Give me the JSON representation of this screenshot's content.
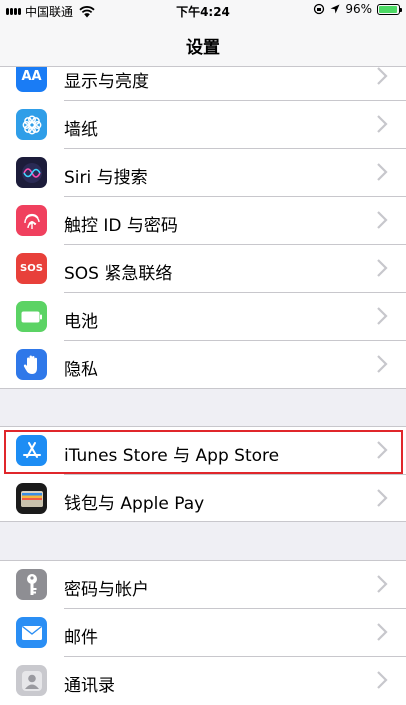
{
  "status": {
    "carrier": "中国联通",
    "time": "下午4:24",
    "battery": "96%",
    "battery_level": 0.96
  },
  "nav": {
    "title": "设置"
  },
  "groups": [
    {
      "items": [
        {
          "label": "显示与亮度",
          "icon": "display-brightness-icon",
          "color": "#1a7cf5"
        },
        {
          "label": "墙纸",
          "icon": "wallpaper-icon",
          "color": "#2f9ee8"
        },
        {
          "label": "Siri 与搜索",
          "icon": "siri-icon",
          "color": "#1c1c3a"
        },
        {
          "label": "触控 ID 与密码",
          "icon": "fingerprint-icon",
          "color": "#f0405e"
        },
        {
          "label": "SOS 紧急联络",
          "icon": "sos-icon",
          "color": "#e8403a"
        },
        {
          "label": "电池",
          "icon": "battery-icon",
          "color": "#5bd364"
        },
        {
          "label": "隐私",
          "icon": "privacy-hand-icon",
          "color": "#2f78e9"
        }
      ]
    },
    {
      "items": [
        {
          "label": "iTunes Store 与 App Store",
          "icon": "app-store-icon",
          "color": "#1d8df4"
        },
        {
          "label": "钱包与 Apple Pay",
          "icon": "wallet-icon",
          "color": "#1b1b1b"
        }
      ]
    },
    {
      "items": [
        {
          "label": "密码与帐户",
          "icon": "key-icon",
          "color": "#8e8e93"
        },
        {
          "label": "邮件",
          "icon": "mail-icon",
          "color": "#2a8ef4"
        },
        {
          "label": "通讯录",
          "icon": "contacts-icon",
          "color": "#c9c9ce"
        }
      ]
    }
  ],
  "icon_text": {
    "sos": "SOS",
    "aa": "AA"
  }
}
